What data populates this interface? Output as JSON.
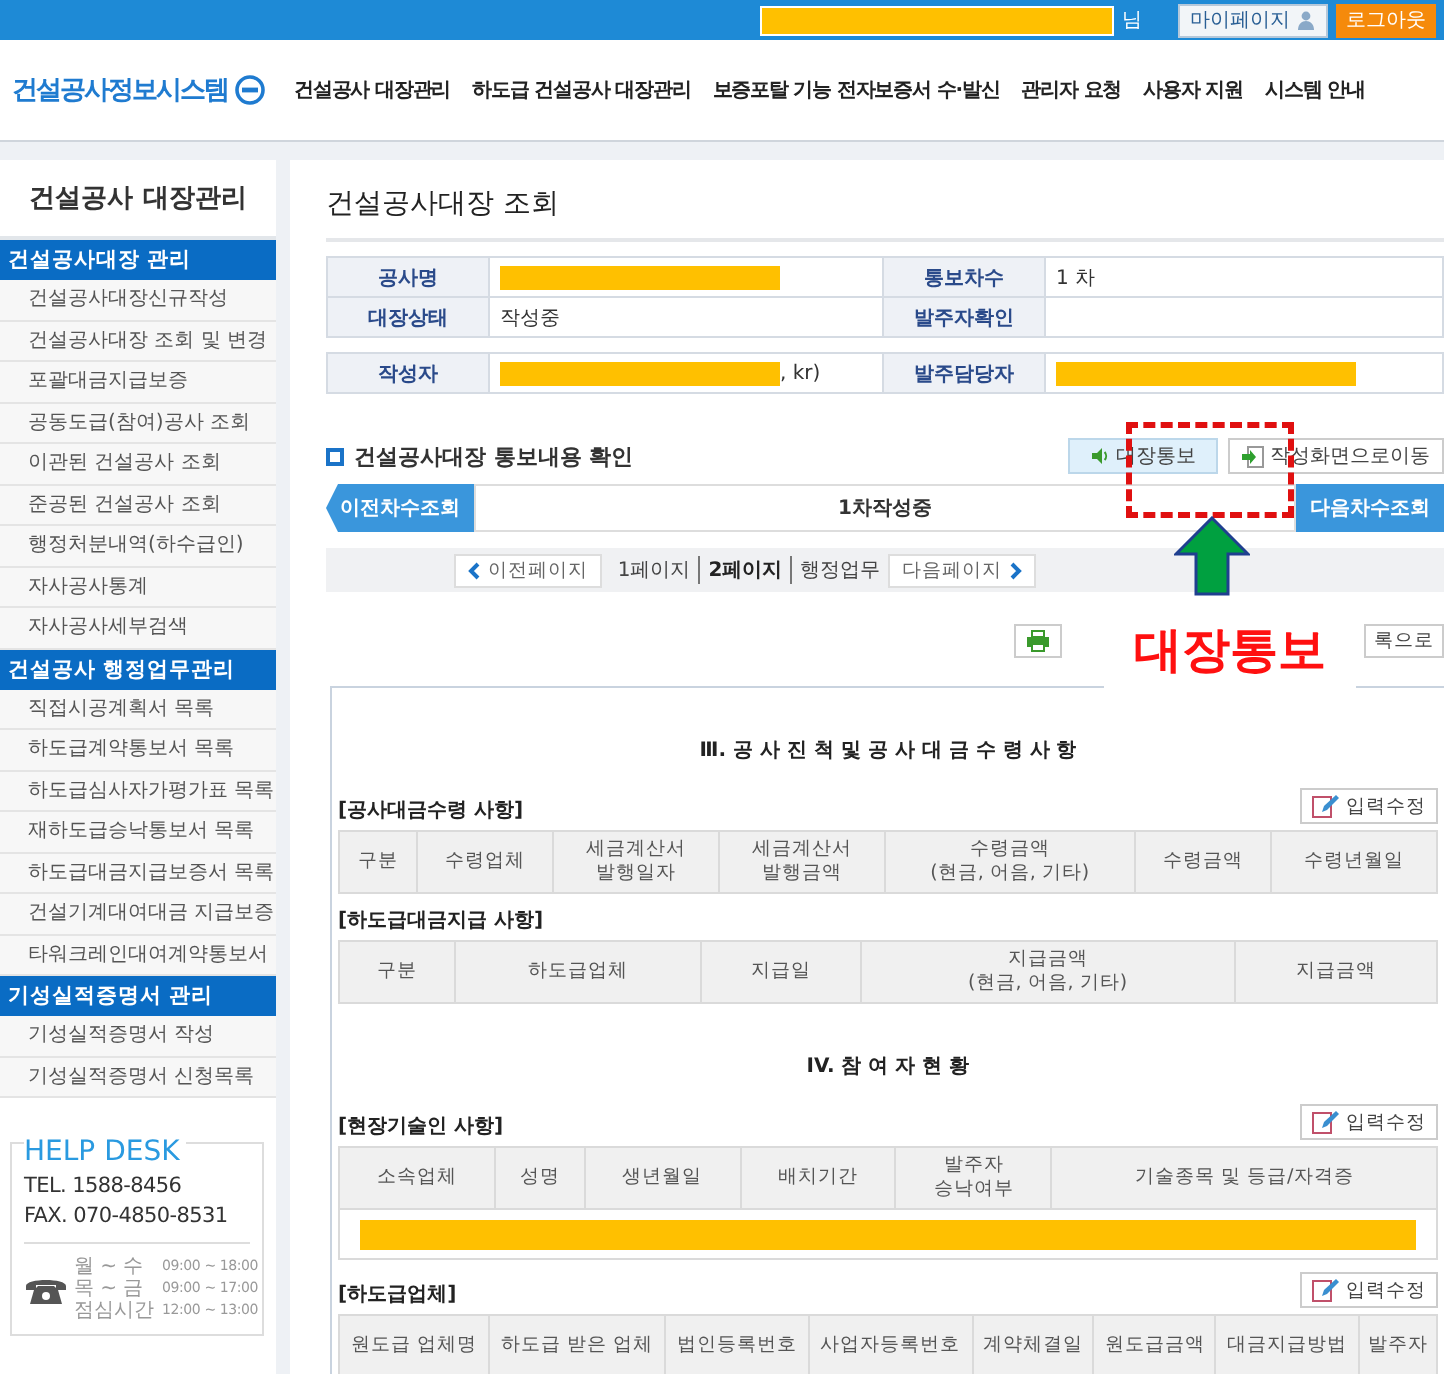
{
  "topbar": {
    "user": {
      "redacted": true,
      "suffix": "님"
    },
    "buttons": [
      {
        "label": "마이페이지",
        "kind": "mypage"
      },
      {
        "label": "로그아웃",
        "kind": "logout"
      }
    ]
  },
  "header": {
    "logo": "건설공사정보시스템",
    "nav": [
      "건설공사 대장관리",
      "하도급 건설공사 대장관리",
      "보증포탈 기능 전자보증서 수·발신",
      "관리자 요청",
      "사용자 지원",
      "시스템 안내"
    ]
  },
  "sidebar": {
    "title": "건설공사 대장관리",
    "groups": [
      {
        "heading": "건설공사대장 관리",
        "items": [
          "건설공사대장신규작성",
          "건설공사대장 조회 및 변경",
          "포괄대금지급보증",
          "공동도급(참여)공사 조회",
          "이관된 건설공사 조회",
          "준공된 건설공사 조회",
          "행정처분내역(하수급인)",
          "자사공사통계",
          "자사공사세부검색"
        ]
      },
      {
        "heading": "건설공사 행정업무관리",
        "items": [
          "직접시공계획서 목록",
          "하도급계약통보서 목록",
          "하도급심사자가평가표 목록",
          "재하도급승낙통보서 목록",
          "하도급대금지급보증서 목록",
          "건설기계대여대금 지급보증",
          "타워크레인대여계약통보서"
        ]
      },
      {
        "heading": "기성실적증명서 관리",
        "items": [
          "기성실적증명서 작성",
          "기성실적증명서 신청목록"
        ]
      }
    ],
    "helpdesk": {
      "title": "HELP DESK",
      "tel": "TEL. 1588-8456",
      "fax": "FAX. 070-4850-8531",
      "hours": [
        {
          "days": "월 ~ 수",
          "time": "09:00 ~ 18:00"
        },
        {
          "days": "목 ~ 금",
          "time": "09:00 ~ 17:00"
        },
        {
          "days": "점심시간",
          "time": "12:00 ~ 13:00"
        }
      ]
    }
  },
  "page_title": "건설공사대장 조회",
  "info": [
    [
      {
        "label": "공사명",
        "redacted": true
      },
      {
        "label": "통보차수",
        "value": "1 차"
      }
    ],
    [
      {
        "label": "대장상태",
        "value": "작성중"
      },
      {
        "label": "발주자확인"
      }
    ]
  ],
  "info2": [
    [
      {
        "label": "작성자",
        "value": ", kr)",
        "redacted": true
      },
      {
        "label": "발주담당자",
        "redacted": true
      }
    ]
  ],
  "section": {
    "title": "건설공사대장 통보내용 확인",
    "buttons": [
      {
        "label": "대장통보",
        "kind": "notify"
      },
      {
        "label": "작성화면으로이동",
        "kind": "goto"
      }
    ]
  },
  "round_nav": {
    "prev": "이전차수조회",
    "current": "1차작성중",
    "next": "다음차수조회"
  },
  "paging": {
    "prev": "이전페이지",
    "next": "다음페이지",
    "pages": [
      {
        "label": "1페이지",
        "selected": false
      },
      {
        "label": "2페이지",
        "selected": true
      },
      {
        "label": "행정업무",
        "selected": false
      }
    ]
  },
  "tools": [
    {
      "kind": "print"
    },
    {
      "kind": "list",
      "label": "록으로"
    }
  ],
  "report": [
    {
      "kind": "heading",
      "text": "Ⅲ. 공 사 진 척 및 공 사 대 금 수 령 사 항"
    },
    {
      "kind": "table",
      "title": "[공사대금수령 사항]",
      "action": "입력수정",
      "columns": [
        "구분",
        "수령업체",
        "세금계산서\n발행일자",
        "세금계산서\n발행금액",
        "수령금액\n(현금, 어음, 기타)",
        "수령금액",
        "수령년월일"
      ]
    },
    {
      "kind": "table",
      "title": "[하도급대금지급 사항]",
      "columns": [
        "구분",
        "하도급업체",
        "지급일",
        "지급금액\n(현금, 어음, 기타)",
        "지급금액"
      ]
    },
    {
      "kind": "heading",
      "text": "IV. 참 여 자 현 황"
    },
    {
      "kind": "table",
      "title": "[현장기술인 사항]",
      "action": "입력수정",
      "columns": [
        "소속업체",
        "성명",
        "생년월일",
        "배치기간",
        "발주자\n승낙여부",
        "기술종목 및 등급/자격증"
      ],
      "redacted_row": true
    },
    {
      "kind": "table",
      "title": "[하도급업체]",
      "action": "입력수정",
      "columns": [
        "원도급 업체명",
        "하도급 받은 업체",
        "법인등록번호",
        "사업자등록번호",
        "계약체결일",
        "원도급금액",
        "대금지급방법",
        "발주자"
      ]
    }
  ],
  "annotations": [
    {
      "kind": "dashed-box"
    },
    {
      "kind": "arrow"
    },
    {
      "kind": "callout",
      "text": "대장통보"
    }
  ]
}
